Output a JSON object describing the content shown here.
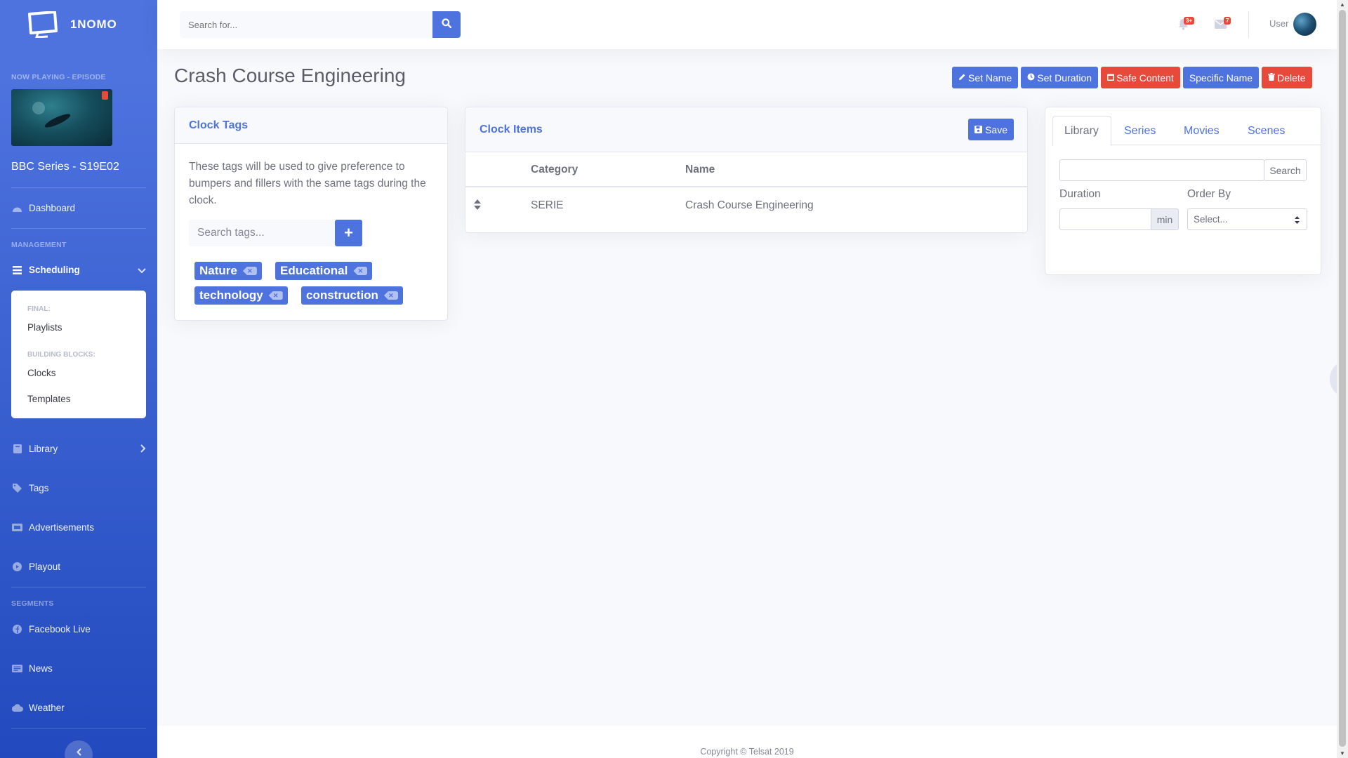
{
  "brand": {
    "name": "1NOMO"
  },
  "sidebar": {
    "now_playing_heading": "Now Playing - Episode",
    "now_playing_title": "BBC Series - S19E02",
    "dashboard": "Dashboard",
    "management_heading": "Management",
    "scheduling": "Scheduling",
    "submenu": {
      "final_heading": "Final:",
      "playlists": "Playlists",
      "building_heading": "Building Blocks:",
      "clocks": "Clocks",
      "templates": "Templates"
    },
    "library": "Library",
    "tags": "Tags",
    "advertisements": "Advertisements",
    "playout": "Playout",
    "segments_heading": "Segments",
    "facebook_live": "Facebook Live",
    "news": "News",
    "weather": "Weather"
  },
  "topbar": {
    "search_placeholder": "Search for...",
    "alerts_badge": "3+",
    "messages_badge": "7",
    "user_name": "User"
  },
  "page": {
    "title": "Crash Course Engineering",
    "actions": {
      "set_name": "Set Name",
      "set_duration": "Set Duration",
      "safe_content": "Safe Content",
      "specific_name": "Specific Name",
      "delete": "Delete"
    }
  },
  "clock_tags": {
    "title": "Clock Tags",
    "description": "These tags will be used to give preference to bumpers and fillers with the same tags during the clock.",
    "search_placeholder": "Search tags...",
    "add_label": "+",
    "tags": [
      "Nature",
      "Educational",
      "technology",
      "construction"
    ]
  },
  "clock_items": {
    "title": "Clock Items",
    "save_label": "Save",
    "columns": {
      "category": "Category",
      "name": "Name"
    },
    "rows": [
      {
        "category": "SERIE",
        "name": "Crash Course Engineering"
      }
    ]
  },
  "library_panel": {
    "tabs": [
      "Library",
      "Series",
      "Movies",
      "Scenes"
    ],
    "active_tab": "Library",
    "search_value": "",
    "search_button": "Search",
    "duration_label": "Duration",
    "duration_unit": "min",
    "order_by_label": "Order By",
    "order_by_selected": "Select..."
  },
  "footer": {
    "copyright": "Copyright © Telsat 2019"
  },
  "colors": {
    "primary": "#4e73df",
    "danger": "#e74a3b",
    "background": "#f8f9fc"
  }
}
